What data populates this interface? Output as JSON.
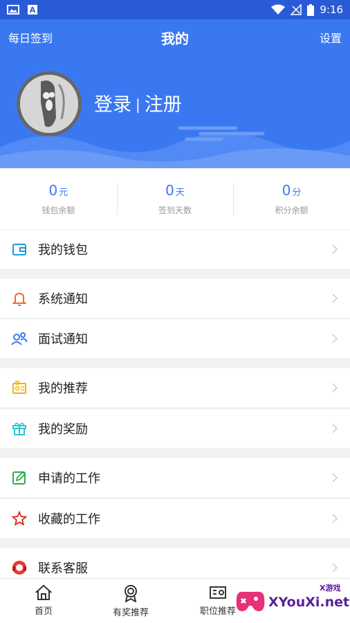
{
  "status_bar": {
    "time": "9:16",
    "left_icons": [
      "image-icon",
      "a-icon"
    ],
    "right_icons": [
      "wifi-icon",
      "no-signal-icon",
      "battery-icon"
    ]
  },
  "header": {
    "sign_in_label": "每日签到",
    "title": "我的",
    "settings_label": "设置",
    "login_label": "登录",
    "separator": "|",
    "register_label": "注册",
    "bg_color": "#3a78f2"
  },
  "stats": [
    {
      "value": "0",
      "unit": "元",
      "label": "钱包余额"
    },
    {
      "value": "0",
      "unit": "天",
      "label": "签到天数"
    },
    {
      "value": "0",
      "unit": "分",
      "label": "积分余额"
    }
  ],
  "menu": {
    "wallet": {
      "label": "我的钱包",
      "icon": "wallet-icon"
    },
    "system_notice": {
      "label": "系统通知",
      "icon": "bell-icon"
    },
    "interview_notice": {
      "label": "面试通知",
      "icon": "people-icon"
    },
    "my_recommend": {
      "label": "我的推荐",
      "icon": "id-card-icon"
    },
    "my_rewards": {
      "label": "我的奖励",
      "icon": "gift-icon"
    },
    "applied_jobs": {
      "label": "申请的工作",
      "icon": "edit-icon"
    },
    "saved_jobs": {
      "label": "收藏的工作",
      "icon": "star-icon"
    },
    "customer_service": {
      "label": "联系客服",
      "icon": "headset-icon"
    }
  },
  "tabbar": [
    {
      "label": "首页",
      "icon": "home-icon"
    },
    {
      "label": "有奖推荐",
      "icon": "medal-icon"
    },
    {
      "label": "职位推荐",
      "icon": "job-icon"
    }
  ],
  "watermark": {
    "text": "XYouXi.net",
    "small": "X游戏"
  },
  "colors": {
    "accent": "#3a78f2",
    "status_bar": "#2a5bd7"
  }
}
